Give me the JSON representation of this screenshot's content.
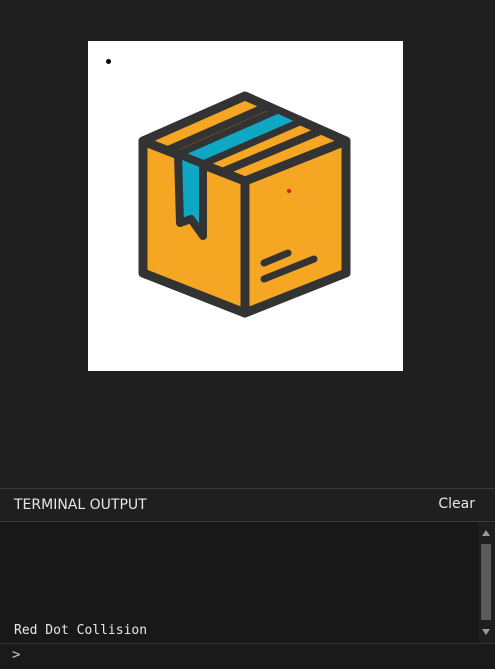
{
  "terminal": {
    "title": "TERMINAL OUTPUT",
    "clear_label": "Clear",
    "output_lines": [
      "Red Dot Collision"
    ],
    "prompt_symbol": ">",
    "input_value": ""
  },
  "colors": {
    "background": "#1f1f1f",
    "box_body": "#f5a623",
    "box_tape": "#0fa8c4",
    "outline": "#333333",
    "red_dot": "#e01818"
  },
  "icons": {
    "box": "package-box-icon"
  }
}
